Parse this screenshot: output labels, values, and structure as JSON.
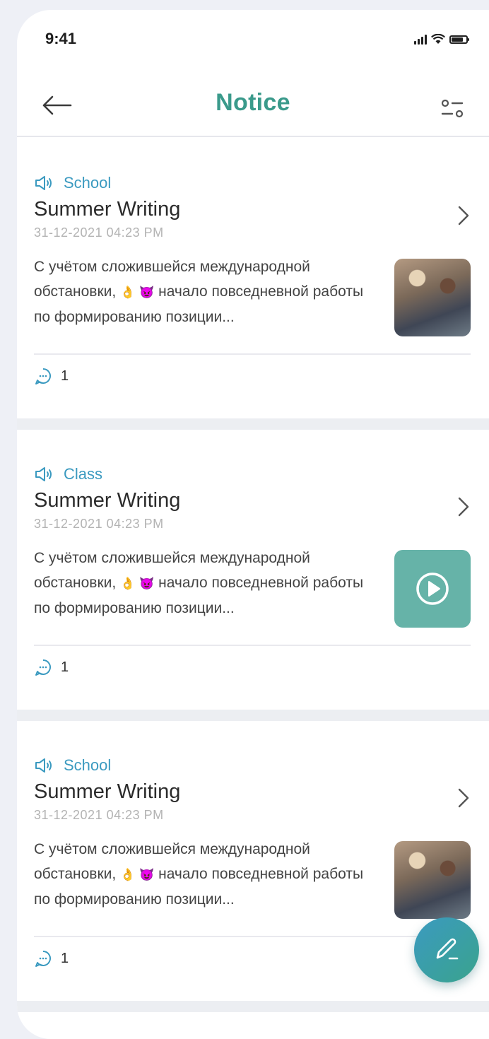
{
  "status_bar": {
    "time": "9:41"
  },
  "header": {
    "title": "Notice"
  },
  "notices": [
    {
      "category": "School",
      "title": "Summer Writing",
      "date": "31-12-2021  04:23 PM",
      "excerpt_before": "С учётом сложившейся международной обстановки,",
      "emoji_1": "👌",
      "emoji_2": "😈",
      "excerpt_after": "начало повседневной работы по формированию позиции...",
      "media": "photo",
      "comments": "1"
    },
    {
      "category": "Class",
      "title": "Summer Writing",
      "date": "31-12-2021  04:23 PM",
      "excerpt_before": "С учётом сложившейся международной обстановки,",
      "emoji_1": "👌",
      "emoji_2": "😈",
      "excerpt_after": "начало повседневной работы по формированию позиции...",
      "media": "video",
      "comments": "1"
    },
    {
      "category": "School",
      "title": "Summer Writing",
      "date": "31-12-2021  04:23 PM",
      "excerpt_before": "С учётом сложившейся международной обстановки,",
      "emoji_1": "👌",
      "emoji_2": "😈",
      "excerpt_after": "начало повседневной работы по формированию позиции...",
      "media": "photo",
      "comments": "1"
    }
  ],
  "icons": {
    "back": "arrow-left-icon",
    "filter": "filter-sliders-icon",
    "category": "megaphone-icon",
    "chevron": "chevron-right-icon",
    "comment": "chat-bubble-icon",
    "play": "play-circle-icon",
    "fab": "pencil-icon"
  },
  "colors": {
    "accent": "#3a9a8b",
    "category": "#3b9ac0",
    "video_tile": "#66b3a8"
  }
}
